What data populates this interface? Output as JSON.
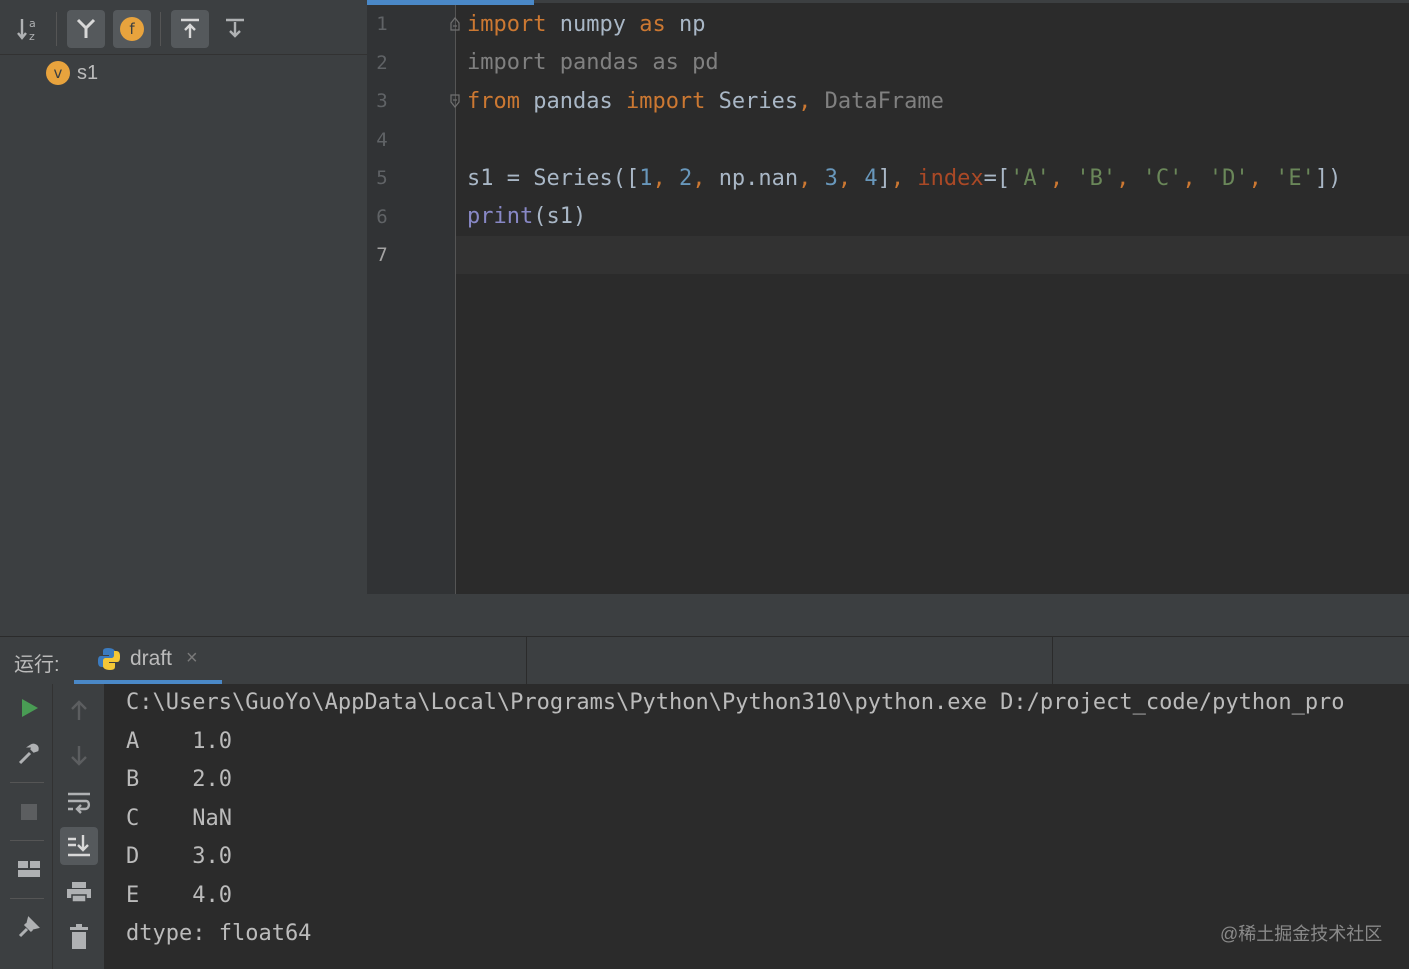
{
  "structure": {
    "toolbar": {
      "sort_icon": "sort-alpha-icon",
      "fields_icon": "field-icon",
      "buttons": [
        "sort",
        "show-inherited",
        "show-fields",
        "expand-all",
        "collapse-all"
      ]
    },
    "tree": [
      {
        "badge": "v",
        "label": "s1"
      }
    ]
  },
  "editor": {
    "line_numbers": [
      "1",
      "2",
      "3",
      "4",
      "5",
      "6",
      "7"
    ],
    "lines": {
      "l1": {
        "k1": "import",
        "t1": " numpy ",
        "k2": "as",
        "t2": " np"
      },
      "l2": {
        "t1": "import pandas as pd"
      },
      "l3": {
        "k1": "from",
        "t1": " pandas ",
        "k2": "import",
        "t2": " Series",
        "p1": ",",
        "d1": " DataFrame"
      },
      "l5": {
        "t1": "s1 = Series([",
        "n1": "1",
        "c1": ", ",
        "n2": "2",
        "c2": ", ",
        "t2": "np.nan",
        "c3": ", ",
        "n3": "3",
        "c4": ", ",
        "n4": "4",
        "t3": "]",
        "c5": ", ",
        "p1": "index",
        "t4": "=[",
        "s1": "'A'",
        "c6": ", ",
        "s2": "'B'",
        "c7": ", ",
        "s3": "'C'",
        "c8": ", ",
        "s4": "'D'",
        "c9": ", ",
        "s5": "'E'",
        "t5": "])"
      },
      "l6": {
        "b1": "print",
        "t1": "(s1)"
      }
    }
  },
  "run": {
    "label": "运行:",
    "tab_name": "draft",
    "tab_close": "×",
    "output": [
      "C:\\Users\\GuoYo\\AppData\\Local\\Programs\\Python\\Python310\\python.exe D:/project_code/python_pro",
      "A    1.0",
      "B    2.0",
      "C    NaN",
      "D    3.0",
      "E    4.0",
      "dtype: float64"
    ]
  },
  "watermark": "@稀土掘金技术社区",
  "colors": {
    "accent": "#4a88c7",
    "run_green": "#499c54",
    "keyword": "#cc7832",
    "number": "#6897bb",
    "string": "#6a8759",
    "param": "#aa4926",
    "builtin": "#8888c6",
    "badge_orange": "#e8a33d"
  }
}
